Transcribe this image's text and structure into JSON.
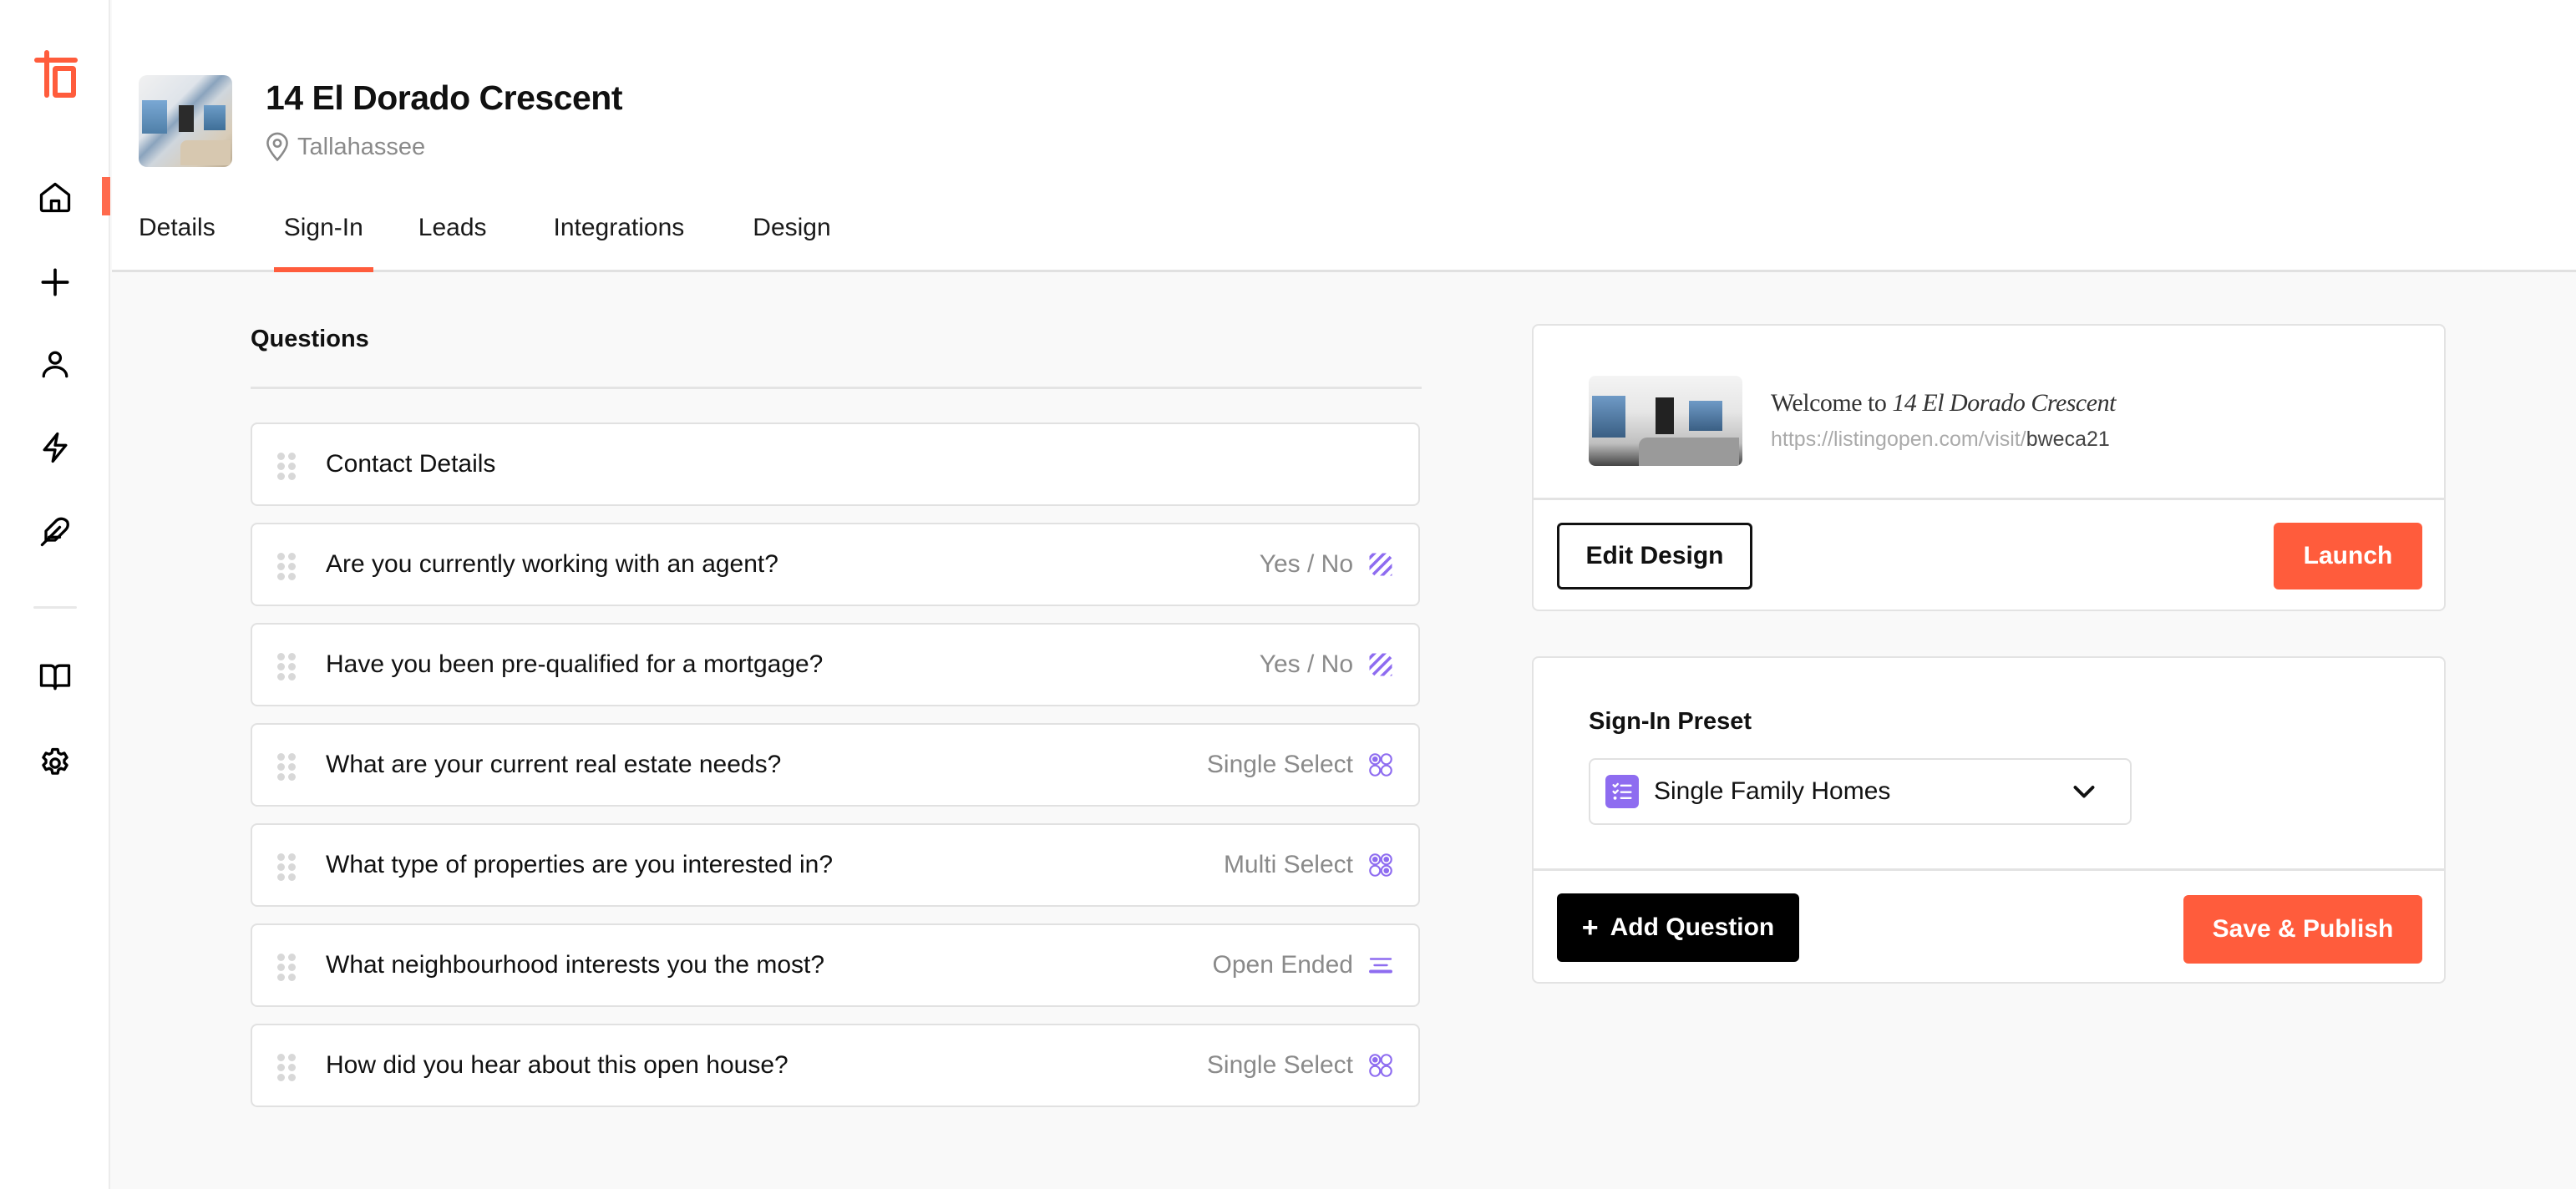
{
  "brand": {
    "accent": "#ff5c3c",
    "type_icon_color": "#8e6cf0"
  },
  "sidebar": {
    "logo": "listingopen-logo",
    "items": [
      {
        "name": "home",
        "icon": "home-icon",
        "active": true
      },
      {
        "name": "create",
        "icon": "plus-icon",
        "active": false
      },
      {
        "name": "contacts",
        "icon": "user-icon",
        "active": false
      },
      {
        "name": "automations",
        "icon": "lightning-icon",
        "active": false
      },
      {
        "name": "design",
        "icon": "feather-icon",
        "active": false
      },
      {
        "name": "guides",
        "icon": "book-icon",
        "active": false
      },
      {
        "name": "settings",
        "icon": "gear-icon",
        "active": false
      }
    ]
  },
  "header": {
    "title": "14 El Dorado Crescent",
    "location": "Tallahassee",
    "tabs": [
      {
        "label": "Details",
        "active": false
      },
      {
        "label": "Sign-In",
        "active": true
      },
      {
        "label": "Leads",
        "active": false
      },
      {
        "label": "Integrations",
        "active": false
      },
      {
        "label": "Design",
        "active": false
      }
    ]
  },
  "questions": {
    "heading": "Questions",
    "items": [
      {
        "text": "Contact Details",
        "type": "",
        "type_icon": ""
      },
      {
        "text": "Are you currently working with an agent?",
        "type": "Yes / No",
        "type_icon": "yes-no-icon"
      },
      {
        "text": "Have you been pre-qualified for a mortgage?",
        "type": "Yes / No",
        "type_icon": "yes-no-icon"
      },
      {
        "text": "What are your current real estate needs?",
        "type": "Single Select",
        "type_icon": "single-select-icon"
      },
      {
        "text": "What type of properties are you interested in?",
        "type": "Multi Select",
        "type_icon": "multi-select-icon"
      },
      {
        "text": "What neighbourhood interests you the most?",
        "type": "Open Ended",
        "type_icon": "open-ended-icon"
      },
      {
        "text": "How did you hear about this open house?",
        "type": "Single Select",
        "type_icon": "single-select-icon"
      }
    ]
  },
  "preview": {
    "welcome_prefix": "Welcome to ",
    "welcome_name": "14 El Dorado Crescent",
    "url_base": "https://listingopen.com/visit/",
    "url_slug": "bweca21",
    "edit_label": "Edit Design",
    "launch_label": "Launch"
  },
  "preset": {
    "label": "Sign-In Preset",
    "selected": "Single Family Homes",
    "add_label": "Add Question",
    "save_label": "Save & Publish"
  }
}
